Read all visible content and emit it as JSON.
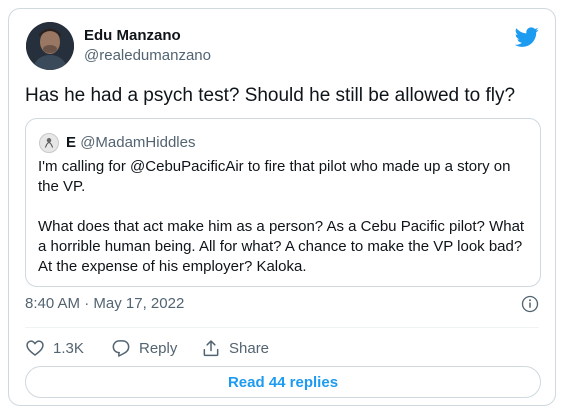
{
  "author": {
    "name": "Edu Manzano",
    "handle": "@realedumanzano",
    "avatar_icon": "profile-photo"
  },
  "tweet": {
    "text": "Has he had a psych test? Should he still be allowed to fly?"
  },
  "quoted": {
    "name": "E",
    "handle": "@MadamHiddles",
    "body": "I'm calling for @CebuPacificAir to fire that pilot who made up a story on the VP.\n\nWhat does that act make him as a person? As a Cebu Pacific pilot? What a horrible human being. All for what? A chance to make the VP look bad? At the expense of his employer? Kaloka."
  },
  "meta": {
    "time": "8:40 AM",
    "separator": " · ",
    "date": "May 17, 2022"
  },
  "actions": {
    "like_count": "1.3K",
    "reply_label": "Reply",
    "share_label": "Share"
  },
  "read_replies": {
    "label": "Read 44 replies"
  },
  "colors": {
    "brand": "#1d9bf0",
    "text": "#0f1419",
    "secondary": "#536471",
    "border": "#cfd9de"
  },
  "icons": {
    "brand": "twitter-bird-icon",
    "info": "info-icon",
    "like": "heart-icon",
    "reply": "reply-bubble-icon",
    "share": "share-upload-icon"
  }
}
